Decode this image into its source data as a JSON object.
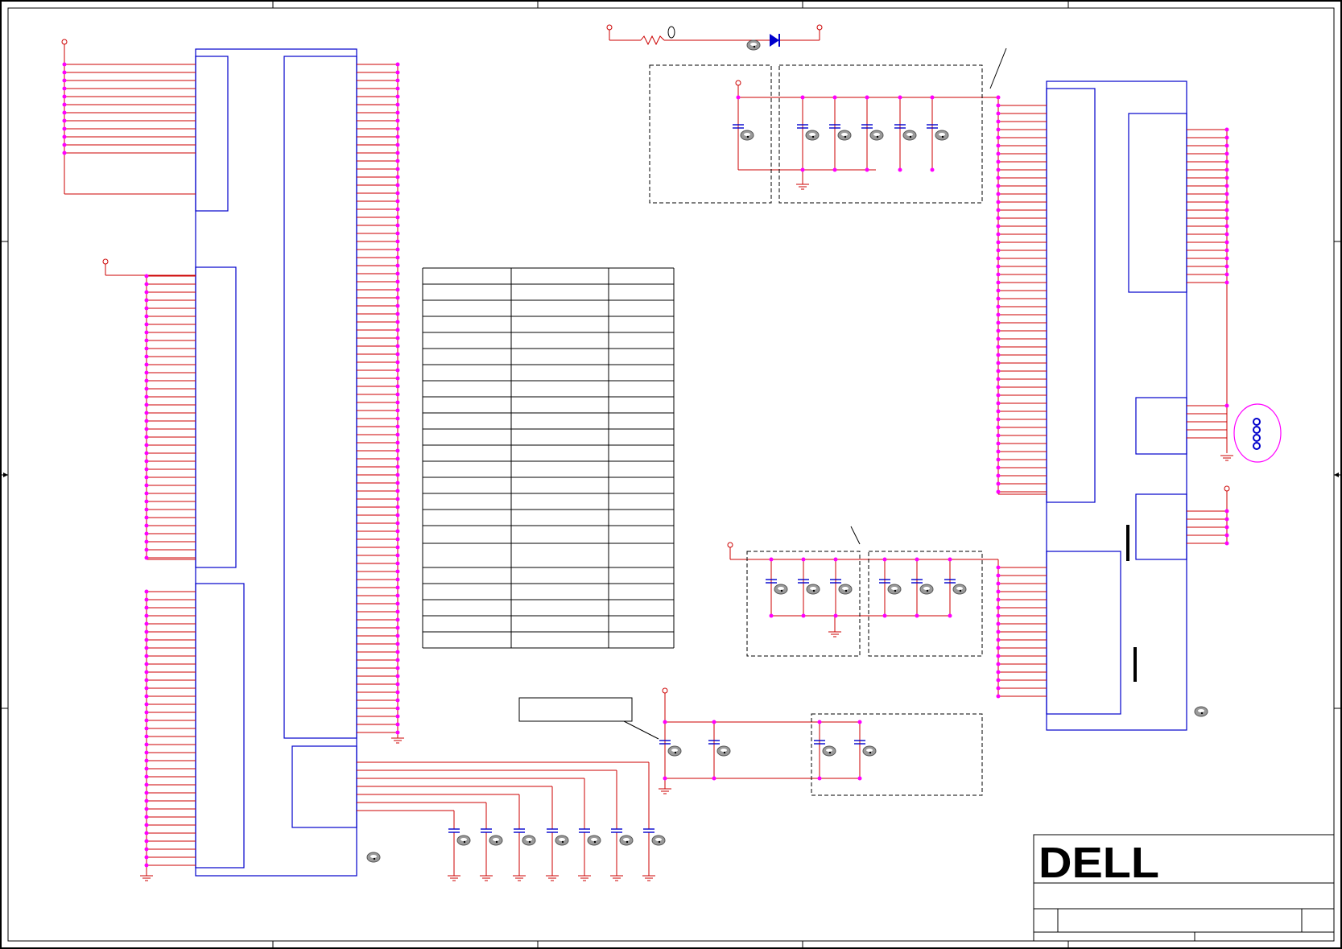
{
  "title_block": {
    "logo_text": "DELL",
    "brand_color": "#000000"
  },
  "colors": {
    "wire": "#cc0000",
    "net_dot": "#ff00ff",
    "part_outline": "#0000cc",
    "frame": "#000000",
    "dashed_box": "#000000",
    "diode_fill": "#0000cc",
    "capacitor": "#0000cc",
    "badge_fill": "#9a9a9a"
  },
  "icons": {
    "component_badge": "eye-badge-icon",
    "ground": "ground-symbol-icon",
    "power_rail": "power-rail-circle-icon",
    "diode": "diode-icon",
    "resistor": "resistor-icon",
    "capacitor": "capacitor-icon",
    "mounting_holes": "connector-pins-icon"
  }
}
